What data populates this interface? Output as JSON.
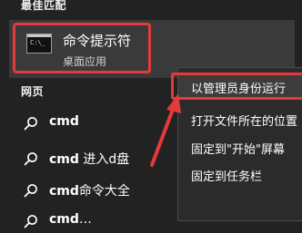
{
  "sections": {
    "best_match": "最佳匹配",
    "web": "网页"
  },
  "best_match_item": {
    "title": "命令提示符",
    "subtitle": "桌面应用",
    "icon": "cmd-icon",
    "icon_prompt": "C:\\_"
  },
  "web_results": [
    {
      "bold": "cmd",
      "rest": ""
    },
    {
      "bold": "cmd",
      "rest": " 进入d盘"
    },
    {
      "bold": "cmd",
      "rest": "命令大全"
    },
    {
      "bold": "cmd",
      "rest": "…"
    }
  ],
  "context_menu": {
    "items": [
      "以管理员身份运行",
      "打开文件所在的位置",
      "固定到\"开始\"屏幕",
      "固定到任务栏"
    ]
  },
  "colors": {
    "annotation": "#e53a3a",
    "background": "#222222"
  }
}
